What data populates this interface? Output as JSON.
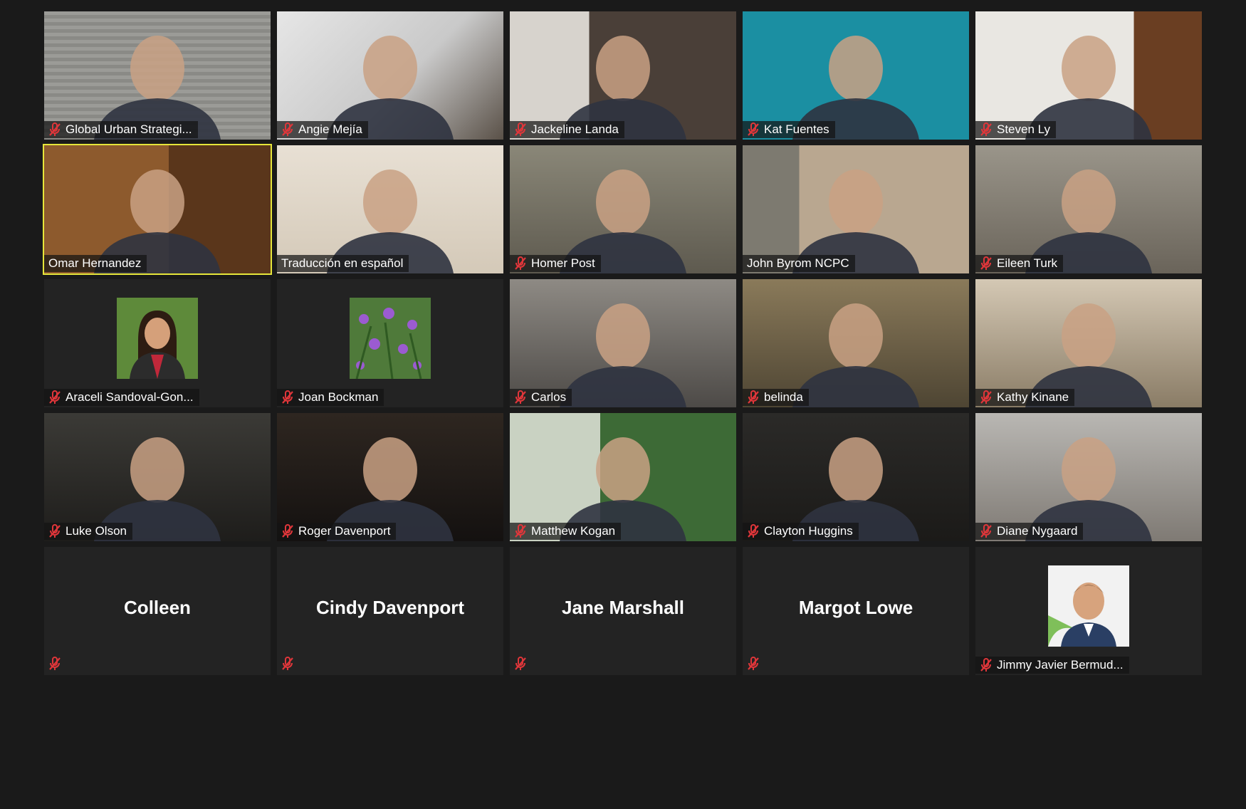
{
  "colors": {
    "background": "#1a1a1a",
    "tile": "#232323",
    "active_speaker_border": "#e6e63a",
    "mute_icon": "#e0363a"
  },
  "participants": [
    {
      "name": "Global Urban Strategi...",
      "muted": true,
      "kind": "video",
      "scene": "bg-blinds"
    },
    {
      "name": "Angie Mejía",
      "muted": true,
      "kind": "video",
      "scene": "bg-room1"
    },
    {
      "name": "Jackeline Landa",
      "muted": true,
      "kind": "video",
      "scene": "bg-room2"
    },
    {
      "name": "Kat Fuentes",
      "muted": true,
      "kind": "video",
      "scene": "bg-teal"
    },
    {
      "name": "Steven Ly",
      "muted": true,
      "kind": "video",
      "scene": "bg-office"
    },
    {
      "name": "Omar Hernandez",
      "muted": false,
      "kind": "video",
      "scene": "bg-wood",
      "active": true
    },
    {
      "name": "Traducción en español",
      "muted": false,
      "kind": "video",
      "scene": "bg-beige"
    },
    {
      "name": "Homer Post",
      "muted": true,
      "kind": "video",
      "scene": "bg-gray"
    },
    {
      "name": "John Byrom NCPC",
      "muted": false,
      "kind": "video",
      "scene": "bg-curt"
    },
    {
      "name": "Eileen Turk",
      "muted": true,
      "kind": "video",
      "scene": "bg-clutter"
    },
    {
      "name": "Araceli Sandoval-Gon...",
      "muted": true,
      "kind": "photo",
      "photo": "portrait"
    },
    {
      "name": "Joan Bockman",
      "muted": true,
      "kind": "photo",
      "photo": "flowers"
    },
    {
      "name": "Carlos",
      "muted": true,
      "kind": "video",
      "scene": "bg-garage"
    },
    {
      "name": "belinda",
      "muted": true,
      "kind": "video",
      "scene": "bg-dim"
    },
    {
      "name": "Kathy Kinane",
      "muted": true,
      "kind": "video",
      "scene": "bg-living"
    },
    {
      "name": "Luke Olson",
      "muted": true,
      "kind": "video",
      "scene": "bg-dark1"
    },
    {
      "name": "Roger Davenport",
      "muted": true,
      "kind": "video",
      "scene": "bg-dark2"
    },
    {
      "name": "Matthew Kogan",
      "muted": true,
      "kind": "video",
      "scene": "bg-green"
    },
    {
      "name": "Clayton Huggins",
      "muted": true,
      "kind": "video",
      "scene": "bg-dark3"
    },
    {
      "name": "Diane Nygaard",
      "muted": true,
      "kind": "video",
      "scene": "bg-light"
    },
    {
      "name": "Colleen",
      "muted": true,
      "kind": "name"
    },
    {
      "name": "Cindy Davenport",
      "muted": true,
      "kind": "name"
    },
    {
      "name": "Jane Marshall",
      "muted": true,
      "kind": "name"
    },
    {
      "name": "Margot Lowe",
      "muted": true,
      "kind": "name"
    },
    {
      "name": "Jimmy Javier Bermud...",
      "muted": true,
      "kind": "photo",
      "photo": "avatar"
    }
  ]
}
